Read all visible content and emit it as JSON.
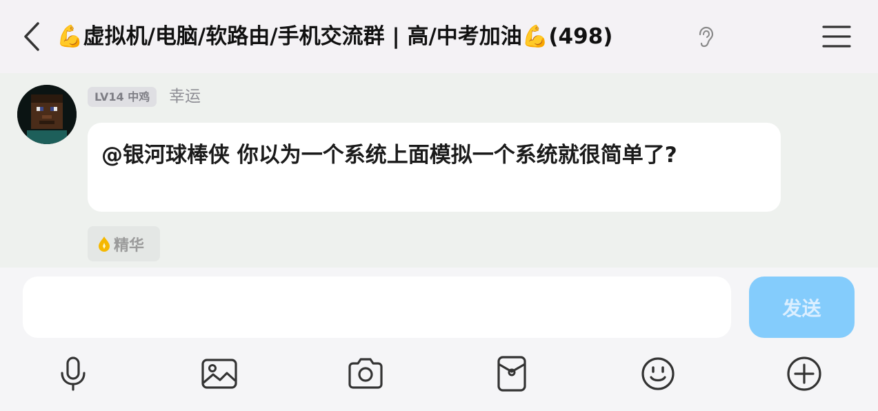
{
  "header": {
    "back_icon": "chevron-left-icon",
    "title": "💪虚拟机/电脑/软路由/手机交流群 | 高/中考加油💪(498)",
    "ear_icon": "ear-icon",
    "menu_icon": "hamburger-menu-icon"
  },
  "message": {
    "level_badge": "LV14 中鸡",
    "sender_nick": "幸运",
    "text": "@银河球棒侠 你以为一个系统上面模拟一个系统就很简单了?",
    "essence_label": "精华",
    "essence_icon": "flame-drop-icon"
  },
  "composer": {
    "input_value": "",
    "send_label": "发送",
    "toolbar": [
      "microphone-icon",
      "image-icon",
      "camera-icon",
      "red-packet-icon",
      "emoji-icon",
      "plus-circle-icon"
    ]
  },
  "colors": {
    "send_button": "#84ccfc",
    "chat_background": "#eef1ee",
    "header_background": "#f4f2f5",
    "essence_icon": "#f5b800"
  }
}
